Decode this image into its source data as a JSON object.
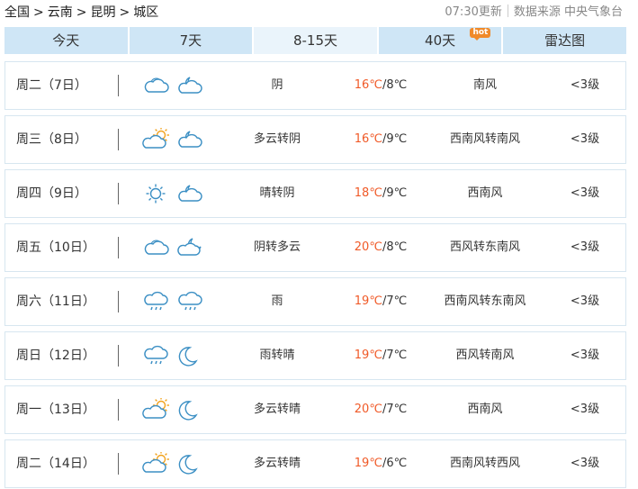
{
  "breadcrumb": {
    "items": [
      "全国",
      "云南",
      "昆明",
      "城区"
    ],
    "separator": ">"
  },
  "meta": {
    "update_time": "07:30更新",
    "source": "数据来源 中央气象台"
  },
  "tabs": [
    {
      "label": "今天",
      "active": false
    },
    {
      "label": "7天",
      "active": false
    },
    {
      "label": "8-15天",
      "active": true
    },
    {
      "label": "40天",
      "active": false,
      "badge": "hot"
    },
    {
      "label": "雷达图",
      "active": false
    }
  ],
  "colors": {
    "high_temp": "#f05a28",
    "tab_bg": "#cfe6f6",
    "tab_active_bg": "#eaf4fb",
    "row_border": "#d7e6f0",
    "icon_stroke": "#3b8fc4",
    "sun": "#f2a21b",
    "hot_badge": "#f08a2a"
  },
  "forecast": [
    {
      "day": "周二（7日）",
      "icons": [
        "cloud-icon",
        "cloudy-night-icon"
      ],
      "weather": "阴",
      "high": "16℃",
      "low": "8℃",
      "wind": "南风",
      "level": "<3级"
    },
    {
      "day": "周三（8日）",
      "icons": [
        "partly-cloudy-icon",
        "cloudy-night-icon"
      ],
      "weather": "多云转阴",
      "high": "16℃",
      "low": "9℃",
      "wind": "西南风转南风",
      "level": "<3级"
    },
    {
      "day": "周四（9日）",
      "icons": [
        "sun-icon",
        "cloudy-night-icon"
      ],
      "weather": "晴转阴",
      "high": "18℃",
      "low": "9℃",
      "wind": "西南风",
      "level": "<3级"
    },
    {
      "day": "周五（10日）",
      "icons": [
        "cloud-icon",
        "partly-cloudy-night-icon"
      ],
      "weather": "阴转多云",
      "high": "20℃",
      "low": "8℃",
      "wind": "西风转东南风",
      "level": "<3级"
    },
    {
      "day": "周六（11日）",
      "icons": [
        "rain-icon",
        "rain-icon"
      ],
      "weather": "雨",
      "high": "19℃",
      "low": "7℃",
      "wind": "西南风转东南风",
      "level": "<3级"
    },
    {
      "day": "周日（12日）",
      "icons": [
        "rain-icon",
        "moon-icon"
      ],
      "weather": "雨转晴",
      "high": "19℃",
      "low": "7℃",
      "wind": "西风转南风",
      "level": "<3级"
    },
    {
      "day": "周一（13日）",
      "icons": [
        "partly-cloudy-icon",
        "moon-icon"
      ],
      "weather": "多云转晴",
      "high": "20℃",
      "low": "7℃",
      "wind": "西南风",
      "level": "<3级"
    },
    {
      "day": "周二（14日）",
      "icons": [
        "partly-cloudy-icon",
        "moon-icon"
      ],
      "weather": "多云转晴",
      "high": "19℃",
      "low": "6℃",
      "wind": "西南风转西风",
      "level": "<3级"
    }
  ]
}
